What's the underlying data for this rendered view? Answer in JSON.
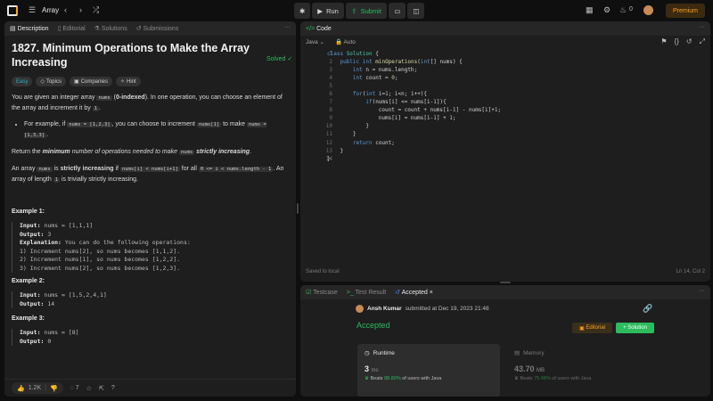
{
  "topbar": {
    "title": "Array",
    "run_label": "Run",
    "submit_label": "Submit",
    "streak": "0",
    "premium_label": "Premium"
  },
  "left_tabs": [
    "Description",
    "Editorial",
    "Solutions",
    "Submissions"
  ],
  "problem": {
    "title": "1827. Minimum Operations to Make the Array Increasing",
    "status": "Solved",
    "chips": [
      "Easy",
      "Topics",
      "Companies",
      "Hint"
    ],
    "p1a": "You are given an integer array ",
    "p1code": "nums",
    "p1b": " (",
    "p1bold": "0-indexed",
    "p1c": "). In one operation, you can choose an element of the array and increment it by ",
    "p1code2": "1",
    "p1d": ".",
    "b1a": "For example, if ",
    "b1code": "nums = [1,2,3]",
    "b1b": ", you can choose to increment ",
    "b1code2": "nums[1]",
    "b1c": " to make ",
    "b1code3": "nums = [1,3,3]",
    "b1d": ".",
    "p2a": "Return the ",
    "p2b": "minimum",
    "p2c": " number of operations needed to make ",
    "p2code": "nums",
    "p2d": "strictly increasing",
    "p2e": ".",
    "p3a": "An array ",
    "p3code": "nums",
    "p3b": " is ",
    "p3bold": "strictly increasing",
    "p3c": " if ",
    "p3code2": "nums[i] < nums[i+1]",
    "p3d": " for all ",
    "p3code3": "0 <= i < nums.length - 1",
    "p3e": ". An array of length ",
    "p3code4": "1",
    "p3f": " is trivially strictly increasing.",
    "examples": [
      {
        "title": "Example 1:",
        "input_label": "Input:",
        "input": "nums = [1,1,1]",
        "output_label": "Output:",
        "output": "3",
        "explanation_label": "Explanation:",
        "explanation": "You can do the following operations:",
        "steps": [
          "1) Increment nums[2], so nums becomes [1,1,2].",
          "2) Increment nums[1], so nums becomes [1,2,2].",
          "3) Increment nums[2], so nums becomes [1,2,3]."
        ]
      },
      {
        "title": "Example 2:",
        "input_label": "Input:",
        "input": "nums = [1,5,2,4,1]",
        "output_label": "Output:",
        "output": "14"
      },
      {
        "title": "Example 3:",
        "input_label": "Input:",
        "input": "nums = [8]",
        "output_label": "Output:",
        "output": "0"
      }
    ]
  },
  "left_footer": {
    "likes": "1.2K",
    "comments": "7"
  },
  "code_panel": {
    "tab": "Code",
    "language": "Java",
    "mode": "Auto",
    "lines": [
      "class Solution {",
      "    public int minOperations(int[] nums) {",
      "        int n = nums.length;",
      "        int count = 0;",
      "",
      "        for(int i=1; i<n; i++){",
      "            if(nums[i] <= nums[i-1]){",
      "                count = count + nums[i-1] - nums[i]+1;",
      "                nums[i] = nums[i-1] + 1;",
      "            }",
      "        }",
      "        return count;",
      "    }",
      "}"
    ],
    "saved_status": "Saved to local",
    "cursor": "Ln 14, Col 2"
  },
  "result_panel": {
    "tabs": [
      "Testcase",
      "Test Result",
      "Accepted"
    ],
    "author": "Ansh Kumar",
    "submitted_text": "submitted at Dec 19, 2023 21:48",
    "status": "Accepted",
    "editorial_label": "Editorial",
    "solution_label": "Solution",
    "runtime": {
      "label": "Runtime",
      "value": "3",
      "unit": "ms",
      "beats_prefix": "Beats ",
      "beats": "88.80%",
      "beats_suffix": " of users with Java"
    },
    "memory": {
      "label": "Memory",
      "value": "43.70",
      "unit": "MB",
      "beats_prefix": "Beats ",
      "beats": "75.48%",
      "beats_suffix": " of users with Java"
    }
  },
  "colors": {
    "accent_green": "#2cbb5d",
    "accent_orange": "#ffa116",
    "easy": "#1cb8b8"
  }
}
